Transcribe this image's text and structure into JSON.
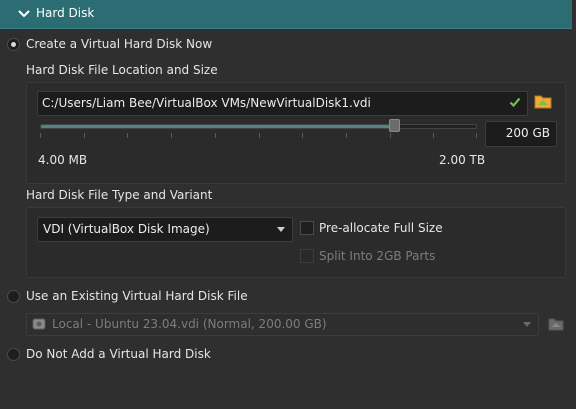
{
  "header": {
    "title": "Hard Disk"
  },
  "options": {
    "create_new": "Create a Virtual Hard Disk Now",
    "use_existing": "Use an Existing Virtual Hard Disk File",
    "do_not_add": "Do Not Add a Virtual Hard Disk"
  },
  "location": {
    "group_label": "Hard Disk File Location and Size",
    "path": "C:/Users/Liam Bee/VirtualBox VMs/NewVirtualDisk1.vdi",
    "size_value": "200 GB",
    "slider_min_label": "4.00 MB",
    "slider_max_label": "2.00 TB",
    "slider_fraction": 0.81
  },
  "type": {
    "group_label": "Hard Disk File Type and Variant",
    "format_selected": "VDI (VirtualBox Disk Image)",
    "preallocate_label": "Pre-allocate Full Size",
    "split_label": "Split Into 2GB Parts"
  },
  "existing": {
    "selected_disk": "Local - Ubuntu 23.04.vdi (Normal, 200.00 GB)"
  },
  "colors": {
    "header_bg": "#2c6d73",
    "accent_check": "#6cc24a",
    "folder_icon": "#f2a93b"
  },
  "icons": {
    "header": "chevron-down-icon",
    "path_valid": "checkmark-icon",
    "choose_file": "folder-icon",
    "disk": "disk-icon",
    "choose_existing": "folder-icon"
  }
}
